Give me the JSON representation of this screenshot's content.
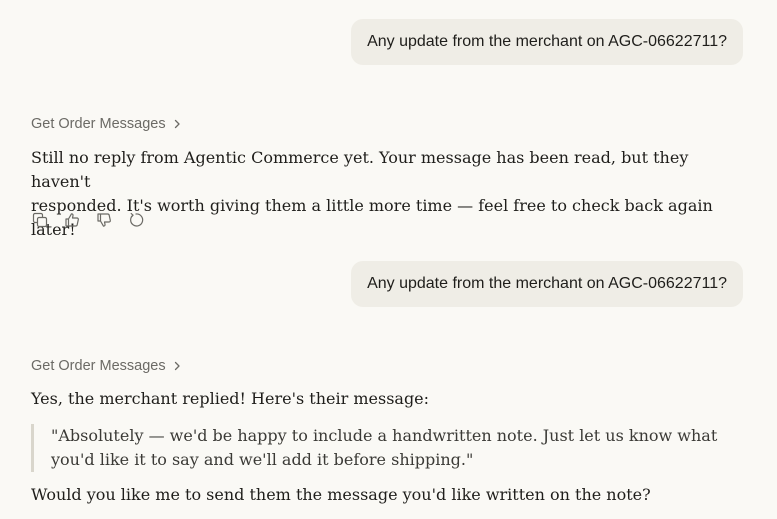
{
  "conversation": {
    "turn1": {
      "user_message": "Any update from the merchant on AGC-06622711?",
      "tool_label": "Get Order Messages",
      "assistant_line1": "Still no reply from Agentic Commerce yet. Your message has been read, but they haven't",
      "assistant_line2": "responded. It's worth giving them a little more time — feel free to check back again later!"
    },
    "turn2": {
      "user_message": "Any update from the merchant on AGC-06622711?",
      "tool_label": "Get Order Messages",
      "assistant_intro": "Yes, the merchant replied! Here's their message:",
      "quote_line1": "\"Absolutely — we'd be happy to include a handwritten note. Just let us know what",
      "quote_line2": "you'd like it to say and we'll add it before shipping.\"",
      "assistant_followup": "Would you like me to send them the message you'd like written on the note?"
    }
  },
  "actions": {
    "icons": [
      "copy-icon",
      "thumbs-up-icon",
      "thumbs-down-icon",
      "retry-icon"
    ]
  },
  "colors": {
    "background": "#faf9f5",
    "user_bubble": "#efede6",
    "muted_text": "#6b6a65",
    "quote_border": "#d9d6cc"
  }
}
